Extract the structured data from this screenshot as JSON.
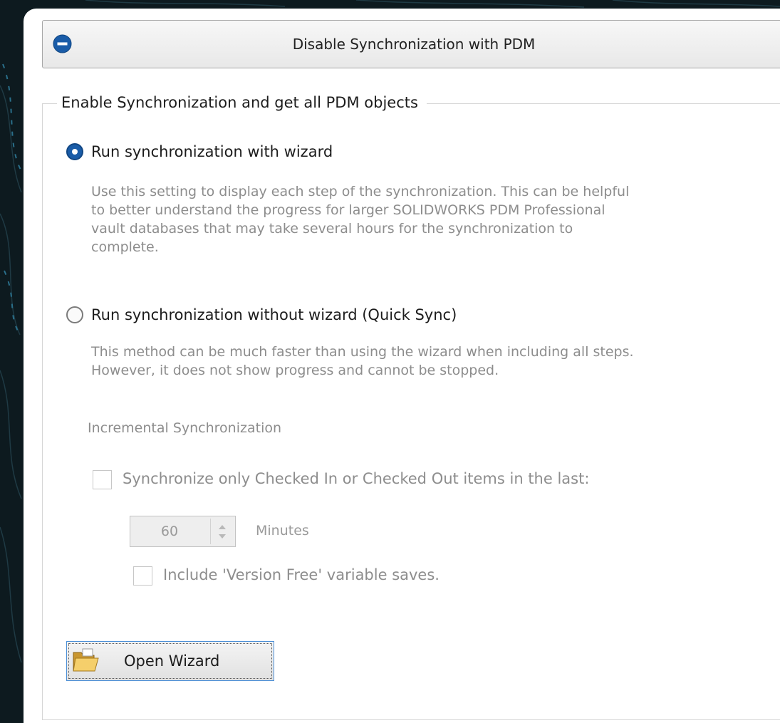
{
  "disable_button": {
    "label": "Disable Synchronization with PDM",
    "icon": "minus-circle-icon"
  },
  "group": {
    "title": "Enable Synchronization and get all PDM objects"
  },
  "options": [
    {
      "label": "Run synchronization with wizard",
      "selected": true,
      "description_lines": [
        "Use this setting to display each step of the synchronization.  This can be helpful",
        "to better understand the progress for larger SOLIDWORKS PDM Professional",
        "vault databases that may take several hours for the synchronization to",
        "complete."
      ]
    },
    {
      "label": "Run synchronization without wizard (Quick Sync)",
      "selected": false,
      "description_lines": [
        "This method can be much faster than using the wizard when including all steps.",
        "However, it does not show progress and cannot be stopped."
      ]
    }
  ],
  "incremental": {
    "title": "Incremental Synchronization",
    "checkbox_label": "Synchronize only Checked In or Checked Out items in the last:",
    "checked": false,
    "value": "60",
    "units": "Minutes",
    "version_free_label": "Include 'Version Free' variable saves.",
    "version_free_checked": false
  },
  "wizard_button": {
    "label": "Open Wizard",
    "icon": "folder-icon"
  },
  "colors": {
    "accent": "#1a5ca8",
    "disabled_text": "#8d8d8d",
    "background": "#0d1a1f"
  }
}
